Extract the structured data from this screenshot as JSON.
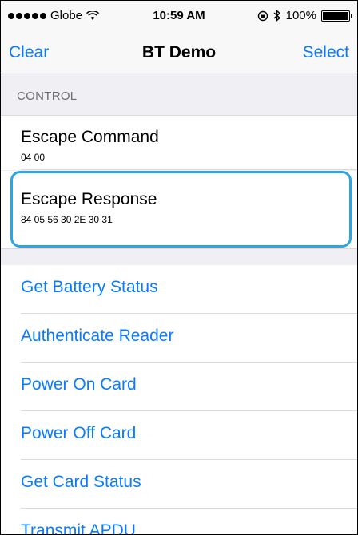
{
  "status_bar": {
    "carrier": "Globe",
    "time": "10:59 AM",
    "battery": "100%",
    "battery_level": 1.0
  },
  "nav": {
    "left": "Clear",
    "title": "BT Demo",
    "right": "Select"
  },
  "section": {
    "header": "CONTROL"
  },
  "control": {
    "items": [
      {
        "title": "Escape Command",
        "value": "04 00"
      },
      {
        "title": "Escape Response",
        "value": "84 05 56 30 2E 30 31"
      }
    ]
  },
  "actions": [
    {
      "label": "Get Battery Status"
    },
    {
      "label": "Authenticate Reader"
    },
    {
      "label": "Power On Card"
    },
    {
      "label": "Power Off Card"
    },
    {
      "label": "Get Card Status"
    },
    {
      "label": "Transmit APDU"
    }
  ],
  "colors": {
    "accent": "#0a7bff",
    "highlight": "#29a6e3"
  }
}
